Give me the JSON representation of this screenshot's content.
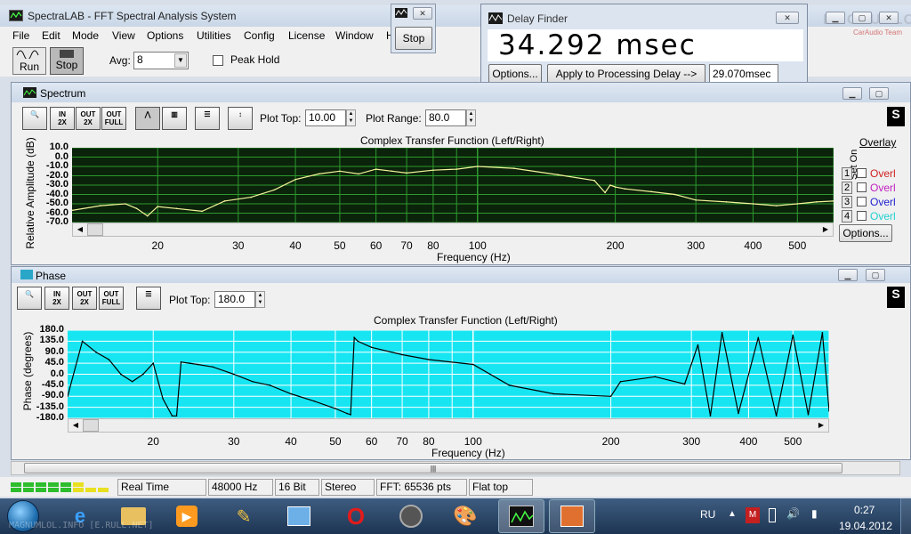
{
  "app": {
    "title": "SpectraLAB - FFT Spectral Analysis System",
    "menu": [
      "File",
      "Edit",
      "Mode",
      "View",
      "Options",
      "Utilities",
      "Config",
      "License",
      "Window",
      "H"
    ]
  },
  "toolbar": {
    "run": "Run",
    "stop": "Stop",
    "avg_label": "Avg:",
    "avg_value": "8",
    "peak_hold": "Peak Hold"
  },
  "stop_popup": {
    "label": "Stop"
  },
  "delay_finder": {
    "title": "Delay Finder",
    "value": "34.292 msec",
    "options": "Options...",
    "apply": "Apply to Processing Delay -->",
    "delay_value": "29.070msec"
  },
  "watermark": {
    "text": "MAGNUMLOL",
    "subtext": "CarAudio Team"
  },
  "spectrum": {
    "title": "Spectrum",
    "plot_top_label": "Plot Top:",
    "plot_top": "10.00",
    "plot_range_label": "Plot Range:",
    "plot_range": "80.0",
    "chart_title": "Complex Transfer Function (Left/Right)",
    "ylabel": "Relative Amplitude (dB)",
    "xlabel": "Frequency (Hz)",
    "overlay": {
      "header": "Overlay",
      "set": "Set",
      "on": "On",
      "items": [
        "Overl",
        "Overl",
        "Overl",
        "Overl"
      ],
      "colors": [
        "#d02020",
        "#c020c0",
        "#2020d0",
        "#20d0d0"
      ],
      "options": "Options..."
    }
  },
  "phase": {
    "title": "Phase",
    "plot_top_label": "Plot Top:",
    "plot_top": "180.0",
    "chart_title": "Complex Transfer Function (Left/Right)",
    "ylabel": "Phase (degrees)",
    "xlabel": "Frequency (Hz)"
  },
  "statusbar": {
    "mode": "Real Time",
    "rate": "48000 Hz",
    "bits": "16 Bit",
    "channels": "Stereo",
    "fft": "FFT: 65536 pts",
    "window": "Flat top"
  },
  "taskbar": {
    "lang": "RU",
    "time": "0:27",
    "date": "19.04.2012",
    "watermark_text": "MAGNUMLOL.INFO [E.RULL.NET]"
  },
  "chart_data": [
    {
      "type": "line",
      "title": "Complex Transfer Function (Left/Right)",
      "xlabel": "Frequency (Hz)",
      "ylabel": "Relative Amplitude (dB)",
      "xscale": "log",
      "xlim": [
        13,
        600
      ],
      "ylim": [
        -70,
        10
      ],
      "yticks": [
        "10.0",
        "0.0",
        "-10.0",
        "-20.0",
        "-30.0",
        "-40.0",
        "-50.0",
        "-60.0",
        "-70.0"
      ],
      "xticks": [
        20,
        30,
        40,
        50,
        60,
        70,
        80,
        100,
        200,
        300,
        400,
        500
      ],
      "x": [
        13,
        15,
        17,
        18,
        19,
        20,
        22,
        25,
        28,
        32,
        36,
        40,
        45,
        50,
        55,
        60,
        65,
        70,
        80,
        90,
        100,
        120,
        150,
        180,
        190,
        195,
        200,
        210,
        240,
        270,
        300,
        350,
        400,
        450,
        500,
        550,
        600
      ],
      "y": [
        -57,
        -52,
        -50,
        -55,
        -63,
        -53,
        -55,
        -58,
        -47,
        -43,
        -35,
        -24,
        -18,
        -15,
        -18,
        -13,
        -15,
        -17,
        -14,
        -13,
        -10,
        -12,
        -19,
        -25,
        -38,
        -30,
        -32,
        -34,
        -37,
        -40,
        -46,
        -48,
        -50,
        -52,
        -50,
        -48,
        -47
      ]
    },
    {
      "type": "line",
      "title": "Complex Transfer Function (Left/Right)",
      "xlabel": "Frequency (Hz)",
      "ylabel": "Phase (degrees)",
      "xscale": "log",
      "xlim": [
        13,
        600
      ],
      "ylim": [
        -180,
        180
      ],
      "yticks": [
        "180.0",
        "135.0",
        "90.0",
        "45.0",
        "0.0",
        "-45.0",
        "-90.0",
        "-135.0",
        "-180.0"
      ],
      "xticks": [
        20,
        30,
        40,
        50,
        60,
        70,
        80,
        100,
        200,
        300,
        400,
        500
      ],
      "x": [
        13,
        14,
        15,
        16,
        17,
        18,
        19,
        20,
        21,
        22,
        22.5,
        23,
        24,
        25,
        27,
        30,
        33,
        36,
        40,
        45,
        50,
        53,
        54,
        55,
        56,
        60,
        70,
        80,
        100,
        120,
        150,
        200,
        210,
        250,
        290,
        310,
        330,
        350,
        380,
        420,
        460,
        500,
        540,
        580,
        600
      ],
      "y": [
        -90,
        135,
        90,
        60,
        0,
        -30,
        0,
        45,
        -100,
        -170,
        -170,
        50,
        45,
        40,
        30,
        0,
        -30,
        -45,
        -80,
        -110,
        -140,
        -160,
        -165,
        150,
        135,
        110,
        80,
        60,
        40,
        -45,
        -80,
        -90,
        -30,
        -10,
        -40,
        120,
        -170,
        170,
        -160,
        150,
        -170,
        160,
        -165,
        170,
        -150
      ]
    }
  ]
}
